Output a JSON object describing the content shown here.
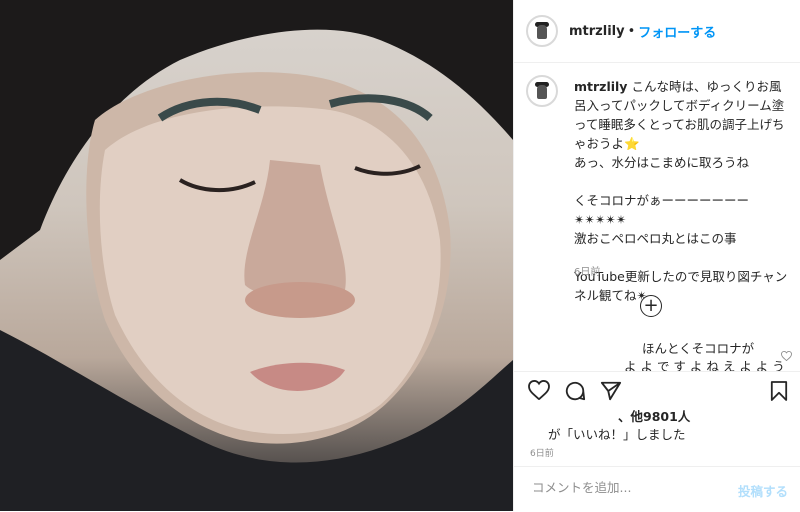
{
  "header": {
    "username": "mtrzlily",
    "separator": "•",
    "follow_label": "フォローする"
  },
  "caption": {
    "username": "mtrzlily",
    "text": "こんな時は、ゆっくりお風呂入ってパックしてボディクリーム塗って睡眠多くとってお肌の調子上げちゃおうよ⭐\nあっ、水分はこまめに取ろうね\n\nくそコロナがぁーーーーーーー✴✴✴✴✴\n激おこペロペロ丸とはこの事\n\nYouTube更新したので見取り図チャンネル観てね✴",
    "time": "6日前"
  },
  "load_more_icon": "plus-circle-icon",
  "comment2": {
    "line1": "ほんとくそコロナが",
    "line2": "よ よ で す よ ね え よ よ う 激 お こ"
  },
  "likes": {
    "count_text": "、他9801人",
    "suffix_text": "が「いいね！」しました"
  },
  "post_date": "6日前",
  "add_comment": {
    "placeholder": "コメントを追加...",
    "post_label": "投稿する"
  },
  "icons": [
    "heart-icon",
    "comment-icon",
    "share-icon",
    "bookmark-icon",
    "small-heart-icon"
  ]
}
